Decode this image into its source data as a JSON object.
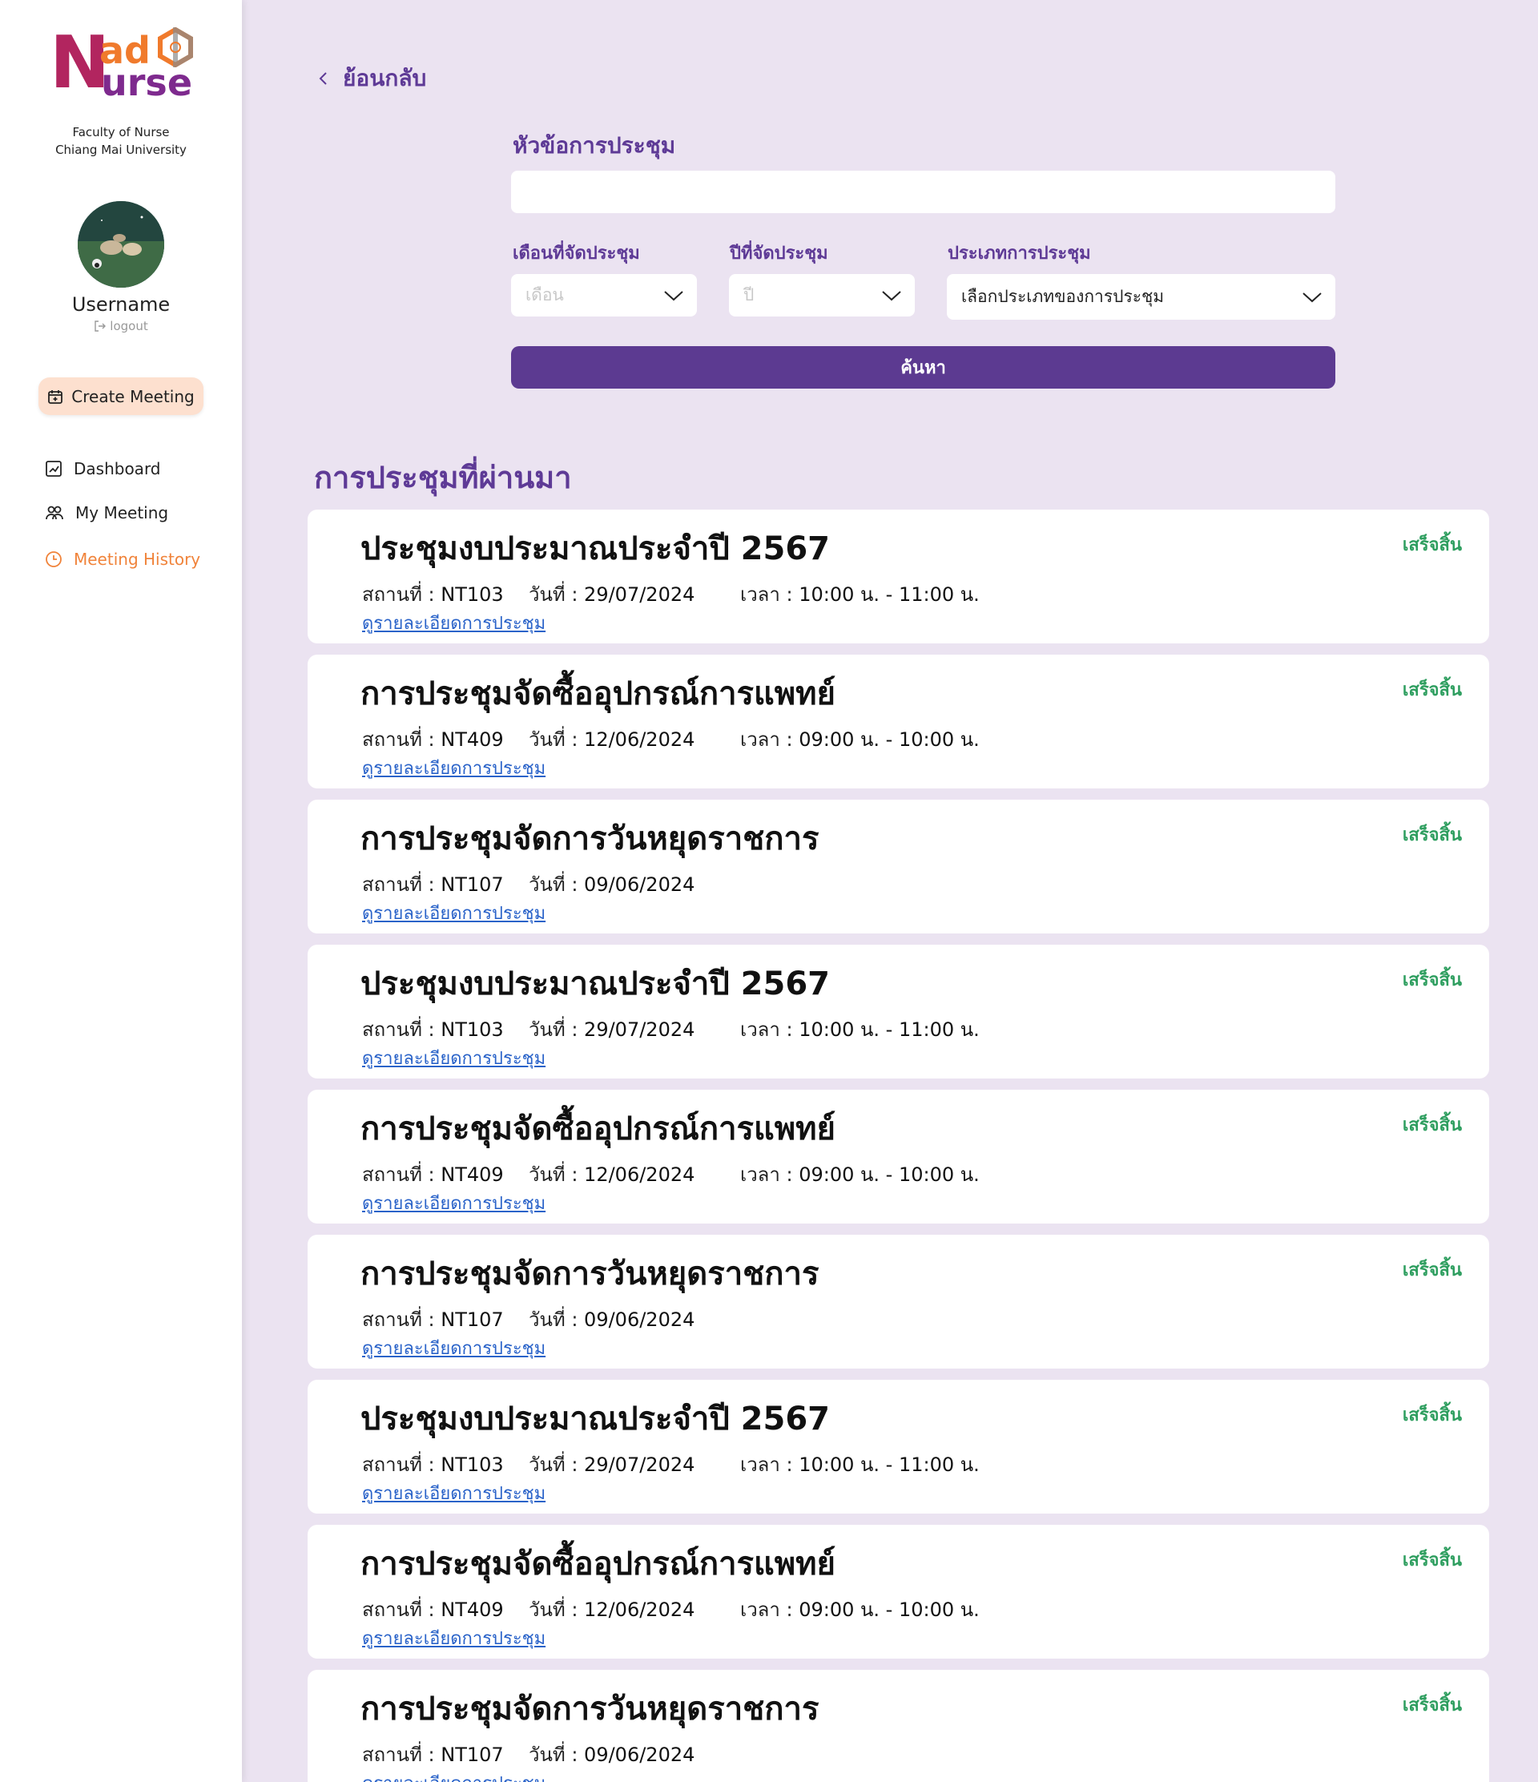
{
  "sidebar": {
    "logo": {
      "n": "N",
      "ad": "ad",
      "urse": "urse"
    },
    "faculty_line1": "Faculty of Nurse",
    "faculty_line2": "Chiang Mai University",
    "username": "Username",
    "logout": "logout",
    "create_meeting": "Create Meeting",
    "nav": [
      {
        "label": "Dashboard",
        "icon": "chart-icon"
      },
      {
        "label": "My Meeting",
        "icon": "people-icon"
      },
      {
        "label": "Meeting History",
        "icon": "clock-icon"
      }
    ]
  },
  "back_label": "ย้อนกลับ",
  "search": {
    "topic_label": "หัวข้อการประชุม",
    "topic_value": "",
    "month_label": "เดือนที่จัดประชุม",
    "month_placeholder": "เดือน",
    "year_label": "ปีที่จัดประชุม",
    "year_placeholder": "ปี",
    "type_label": "ประเภทการประชุม",
    "type_value": "เลือกประเภทของการประชุม",
    "button": "ค้นหา"
  },
  "section_title": "การประชุมที่ผ่านมา",
  "labels": {
    "place": "สถานที่ : ",
    "date": "วันที่ : ",
    "time": "เวลา : ",
    "detail_link": "ดูรายละเอียดการประชุม"
  },
  "meetings": [
    {
      "title": "ประชุมงบประมาณประจำปี 2567",
      "status": "เสร็จสิ้น",
      "place": "NT103",
      "date": "29/07/2024",
      "time": "10:00 น. - 11:00 น."
    },
    {
      "title": "การประชุมจัดซื้ออุปกรณ์การแพทย์",
      "status": "เสร็จสิ้น",
      "place": "NT409",
      "date": "12/06/2024",
      "time": "09:00 น. - 10:00 น."
    },
    {
      "title": "การประชุมจัดการวันหยุดราชการ",
      "status": "เสร็จสิ้น",
      "place": "NT107",
      "date": "09/06/2024",
      "time": ""
    },
    {
      "title": "ประชุมงบประมาณประจำปี 2567",
      "status": "เสร็จสิ้น",
      "place": "NT103",
      "date": "29/07/2024",
      "time": "10:00 น. - 11:00 น."
    },
    {
      "title": "การประชุมจัดซื้ออุปกรณ์การแพทย์",
      "status": "เสร็จสิ้น",
      "place": "NT409",
      "date": "12/06/2024",
      "time": "09:00 น. - 10:00 น."
    },
    {
      "title": "การประชุมจัดการวันหยุดราชการ",
      "status": "เสร็จสิ้น",
      "place": "NT107",
      "date": "09/06/2024",
      "time": ""
    },
    {
      "title": "ประชุมงบประมาณประจำปี 2567",
      "status": "เสร็จสิ้น",
      "place": "NT103",
      "date": "29/07/2024",
      "time": "10:00 น. - 11:00 น."
    },
    {
      "title": "การประชุมจัดซื้ออุปกรณ์การแพทย์",
      "status": "เสร็จสิ้น",
      "place": "NT409",
      "date": "12/06/2024",
      "time": "09:00 น. - 10:00 น."
    },
    {
      "title": "การประชุมจัดการวันหยุดราชการ",
      "status": "เสร็จสิ้น",
      "place": "NT107",
      "date": "09/06/2024",
      "time": ""
    }
  ],
  "colors": {
    "accent": "#5c3a91",
    "sidebar_active": "#f0833a",
    "status_done": "#2e9e5f",
    "background": "#ebe3f1"
  }
}
